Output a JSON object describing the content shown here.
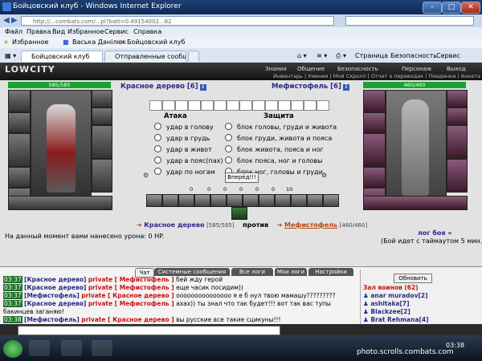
{
  "window": {
    "title": "Бойцовский клуб - Windows Internet Explorer",
    "url": "http://...combats.com/...pl?batt=0.49154002...82"
  },
  "menubar": [
    "Файл",
    "Правка",
    "Вид",
    "Избранное",
    "Сервис",
    "Справка"
  ],
  "favorites": {
    "label": "Избранное",
    "items": [
      "Васька Данілюк",
      "Бойцовский клуб"
    ]
  },
  "tabs": [
    "Бойцовский клуб",
    "Отправленные сообщен..."
  ],
  "ie_tools": [
    "Страница",
    "Безопасность",
    "Сервис"
  ],
  "game": {
    "logo": "LOWCITY",
    "menu": [
      "Знания",
      "Общение",
      "Безопасность",
      "Персонаж",
      "Выход"
    ],
    "submenu": "Инвентарь | Умения | Мой Скролл | Отчет о переводах | Поединки | Анкета",
    "left_fighter": {
      "name": "Красное дерево [6]",
      "hp": "585/585"
    },
    "right_fighter": {
      "name": "Мефистофель [6]",
      "hp": "460/460"
    },
    "attack": {
      "title": "Атака",
      "options": [
        "удар в голову",
        "удар в грудь",
        "удар в живот",
        "удар в пояс(пах)",
        "удар по ногам"
      ]
    },
    "defense": {
      "title": "Защита",
      "options": [
        "блок головы, груди и живота",
        "блок груди, живота и пояса",
        "блок живота, пояса и ног",
        "блок пояса, ног и головы",
        "блок ног, головы и груди"
      ]
    },
    "forward_label": "Вперёд!!!",
    "stats": [
      "0",
      "0",
      "0",
      "0",
      "0",
      "0",
      "10"
    ],
    "vs_line": {
      "left": "Красное дерево",
      "left_hp": "[585/585]",
      "vs": "против",
      "right": "Мефистофель",
      "right_hp": "[460/460]"
    },
    "damage_text": "На данный момент вами нанесено урона: 0 HP.",
    "battle_log": "лог боя »",
    "timeout_text": "(Бой идет с таймаутом 5 мин.)"
  },
  "chat": {
    "tabs": [
      "Чат",
      "Системные сообщения",
      "Все логи",
      "Мои логи",
      "Настройки"
    ],
    "lines": [
      {
        "time": "03:37",
        "nick": "[Красное дерево]",
        "priv": "private [ Мефистофель ]",
        "text": "бей жду герой"
      },
      {
        "time": "03:37",
        "nick": "[Красное дерево]",
        "priv": "private [ Мефистофель ]",
        "text": "еще часик посидим))"
      },
      {
        "time": "03:37",
        "nick": "[Мефистофель]",
        "priv": "private [ Красное дерево ]",
        "text": "ооооооооооооооо я е б нул твою мамашу?????????"
      },
      {
        "time": "03:37",
        "nick": "[Красное дерево]",
        "priv": "private [ Мефистофель ]",
        "text": "ахах)) ты знал что так будет!!! вот так вас тупы"
      },
      {
        "time": "",
        "nick": "",
        "priv": "",
        "text": "бакинцев заганяю!"
      },
      {
        "time": "03:38",
        "nick": "[Мефистофель]",
        "priv": "private [ Красное дерево ]",
        "text": "вы русские все такие сцикуны!!!"
      }
    ]
  },
  "players": {
    "refresh_label": "Обновить",
    "hall_title": "Зал воинов (62)",
    "list": [
      "anar muradov[2]",
      "ashitaka[7]",
      "Blackzee[2]",
      "Brat Rehmana[4]"
    ]
  },
  "taskbar": {
    "clock": "03:38"
  },
  "watermark": "photo.scrolls.combats.com",
  "colors": {
    "hp_bar": "#18a330",
    "nick": "#2a2a8a",
    "private": "#cc1111"
  }
}
